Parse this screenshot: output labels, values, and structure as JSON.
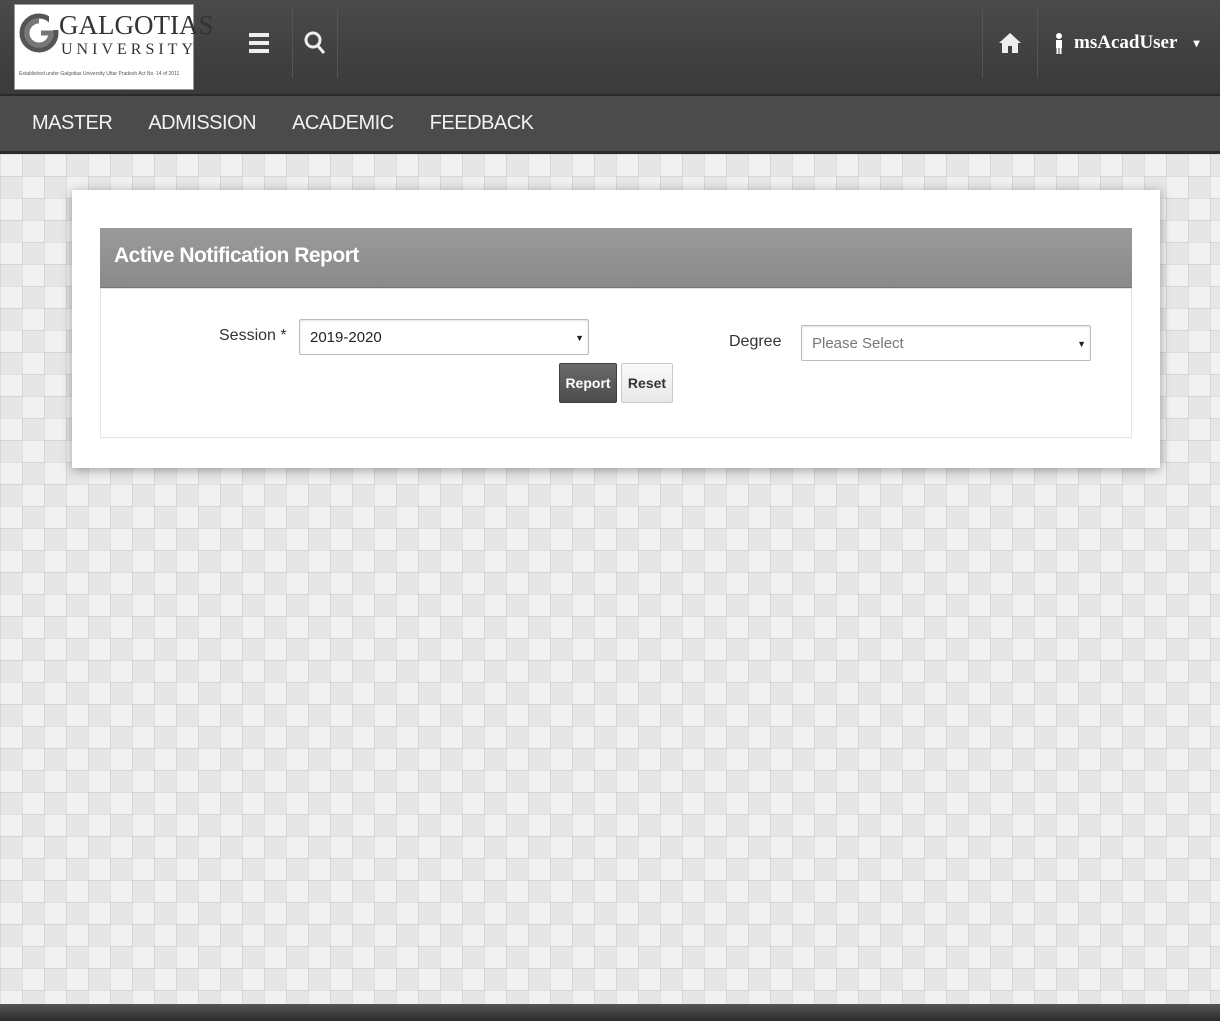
{
  "header": {
    "logo": {
      "name": "GALGOTIAS",
      "sub": "UNIVERSITY",
      "tagline": "Established under Galgotias University Uttar Pradesh Act No. 14 of 2011"
    },
    "menu_icon": "hamburger-icon",
    "search_icon": "search-icon",
    "home_icon": "home-icon",
    "user": {
      "name": "msAcadUser",
      "icon": "user-icon",
      "caret": "▾"
    }
  },
  "nav": {
    "items": [
      "MASTER",
      "ADMISSION",
      "ACADEMIC",
      "FEEDBACK"
    ]
  },
  "card": {
    "title": "Active Notification Report",
    "session": {
      "label": "Session *",
      "value": "2019-2020"
    },
    "degree": {
      "label": "Degree",
      "placeholder": "Please Select"
    },
    "buttons": {
      "report": "Report",
      "reset": "Reset"
    }
  },
  "colors": {
    "header_bg": "#404040",
    "nav_bg": "#4b4b4b",
    "card_head_bg": "#929292",
    "report_button": "#555555"
  }
}
